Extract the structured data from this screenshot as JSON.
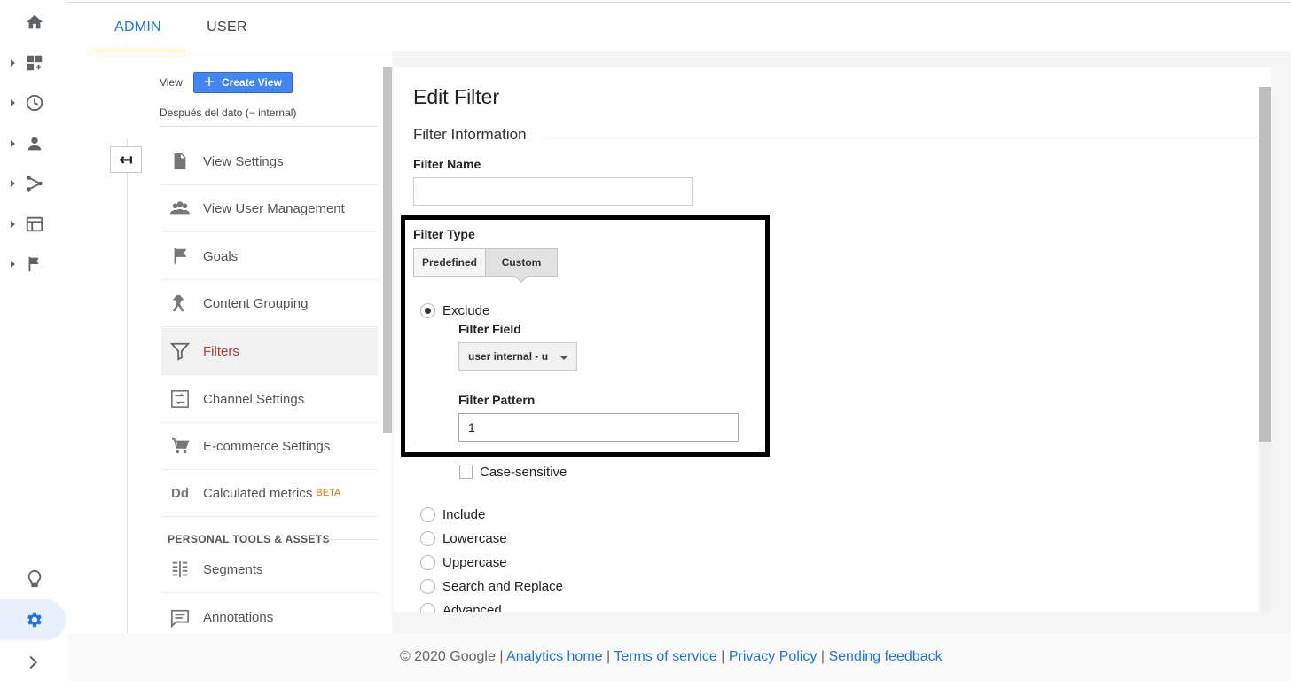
{
  "tabs": {
    "admin": "ADMIN",
    "user": "USER"
  },
  "sidebar": {
    "icons": [
      "home-icon",
      "dashboard-icon",
      "clock-icon",
      "person-icon",
      "acquisition-icon",
      "browser-icon",
      "flag-icon"
    ],
    "bottom_icons": [
      "lightbulb-icon",
      "gear-icon",
      "chevron-right-icon"
    ]
  },
  "view_panel": {
    "view_label": "View",
    "create_view": "Create View",
    "view_name": "Después del dato (¬ internal)",
    "items": [
      {
        "label": "View Settings",
        "icon": "document-icon"
      },
      {
        "label": "View User Management",
        "icon": "people-icon"
      },
      {
        "label": "Goals",
        "icon": "flag-icon"
      },
      {
        "label": "Content Grouping",
        "icon": "content-grouping-icon"
      },
      {
        "label": "Filters",
        "icon": "funnel-icon"
      },
      {
        "label": "Channel Settings",
        "icon": "channel-icon"
      },
      {
        "label": "E-commerce Settings",
        "icon": "cart-icon"
      },
      {
        "label": "Calculated metrics",
        "icon": "dd-icon",
        "badge": "BETA"
      }
    ],
    "section_title": "PERSONAL TOOLS & ASSETS",
    "personal_items": [
      {
        "label": "Segments",
        "icon": "segments-icon"
      },
      {
        "label": "Annotations",
        "icon": "annotation-icon"
      }
    ]
  },
  "edit_filter": {
    "title": "Edit Filter",
    "section": "Filter Information",
    "filter_name_label": "Filter Name",
    "filter_name_value": "",
    "filter_type_label": "Filter Type",
    "type_predefined": "Predefined",
    "type_custom": "Custom",
    "exclude": "Exclude",
    "filter_field_label": "Filter Field",
    "filter_field_value": "user internal - u",
    "filter_pattern_label": "Filter Pattern",
    "filter_pattern_value": "1",
    "case_sensitive": "Case-sensitive",
    "options": [
      "Include",
      "Lowercase",
      "Uppercase",
      "Search and Replace",
      "Advanced"
    ]
  },
  "footer": {
    "copyright": "© 2020 Google",
    "links": [
      "Analytics home",
      "Terms of service",
      "Privacy Policy",
      "Sending feedback"
    ],
    "separator": "|"
  },
  "colors": {
    "accent": "#1a73e8",
    "active_filter": "#c0392b",
    "tab_underline": "#f4b400",
    "button": "#4285f4",
    "beta": "#e37400"
  }
}
